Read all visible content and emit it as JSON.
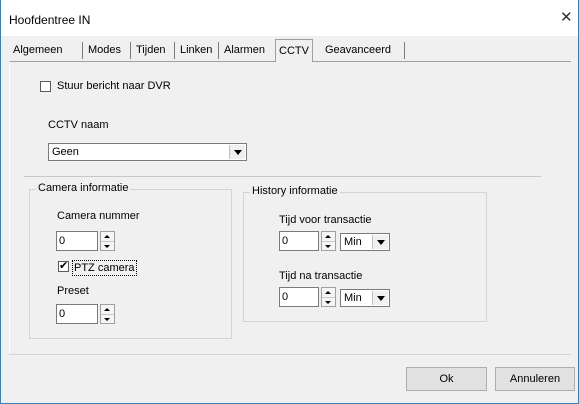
{
  "window": {
    "title": "Hoofdentree IN"
  },
  "tabs": [
    {
      "label": "Algemeen"
    },
    {
      "label": "Modes"
    },
    {
      "label": "Tijden"
    },
    {
      "label": "Linken"
    },
    {
      "label": "Alarmen"
    },
    {
      "label": "CCTV"
    },
    {
      "label": "Geavanceerd"
    }
  ],
  "cctv": {
    "send_to_dvr_label": "Stuur bericht naar DVR",
    "send_to_dvr_checked": false,
    "cctv_name_label": "CCTV naam",
    "cctv_name_value": "Geen"
  },
  "camera_group": {
    "title": "Camera informatie",
    "camera_number_label": "Camera nummer",
    "camera_number_value": "0",
    "ptz_label": "PTZ camera",
    "ptz_mark": "✔",
    "ptz_checked": true,
    "preset_label": "Preset",
    "preset_value": "0"
  },
  "history_group": {
    "title": "History informatie",
    "before_label": "Tijd voor transactie",
    "before_value": "0",
    "before_unit": "Min",
    "after_label": "Tijd na transactie",
    "after_value": "0",
    "after_unit": "Min"
  },
  "buttons": {
    "ok": "Ok",
    "cancel": "Annuleren"
  },
  "icons": {
    "close": "close-icon",
    "dropdown": "chevron-down-icon"
  }
}
